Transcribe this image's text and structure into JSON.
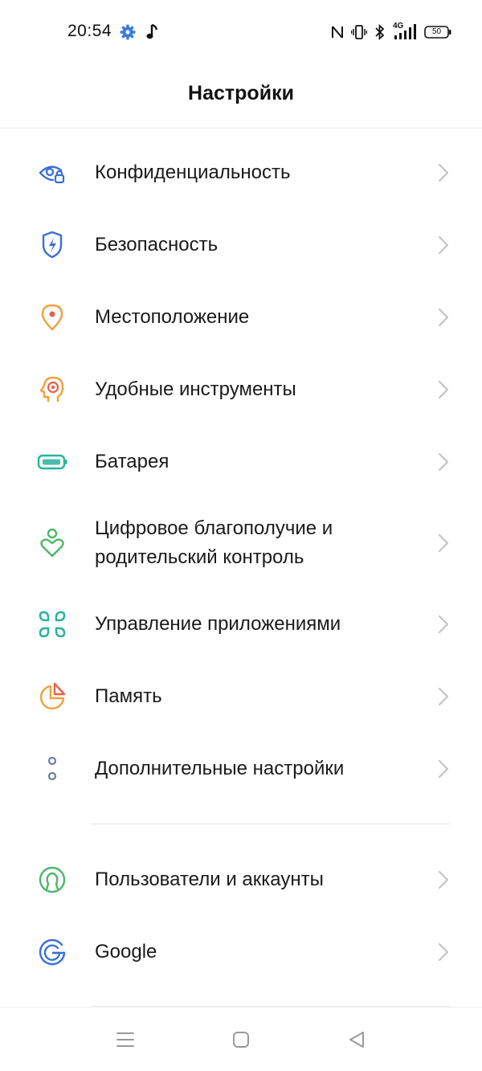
{
  "status_bar": {
    "time": "20:54",
    "icons_left": [
      "gear-icon",
      "music-note-icon"
    ],
    "icons_right": [
      "nfc-icon",
      "vibrate-icon",
      "bluetooth-icon",
      "signal-4g-icon",
      "battery-icon"
    ],
    "network_label": "4G",
    "battery_level": "50"
  },
  "header": {
    "title": "Настройки"
  },
  "settings": {
    "items": [
      {
        "label": "Конфиденциальность",
        "icon": "privacy-eye-icon",
        "color": "#3a6fd8"
      },
      {
        "label": "Безопасность",
        "icon": "shield-bolt-icon",
        "color": "#3a6fd8"
      },
      {
        "label": "Местоположение",
        "icon": "location-pin-icon",
        "color": "#f0a23a"
      },
      {
        "label": "Удобные инструменты",
        "icon": "head-target-icon",
        "color": "#f0a23a"
      },
      {
        "label": "Батарея",
        "icon": "battery-icon",
        "color": "#27b39a"
      },
      {
        "label": "Цифровое благополучие и родительский контроль",
        "icon": "person-heart-icon",
        "color": "#4cb86a"
      },
      {
        "label": "Управление приложениями",
        "icon": "apps-grid-icon",
        "color": "#27b39a"
      },
      {
        "label": "Память",
        "icon": "storage-pie-icon",
        "color": "#f0a23a"
      },
      {
        "label": "Дополнительные настройки",
        "icon": "more-dots-icon",
        "color": "#6d7ea0"
      }
    ],
    "account_items": [
      {
        "label": "Пользователи и аккаунты",
        "icon": "user-circle-icon",
        "color": "#4cb86a"
      },
      {
        "label": "Google",
        "icon": "google-g-icon",
        "color": "#3a6fd8"
      }
    ]
  },
  "nav_bar": {
    "buttons": [
      "menu-icon",
      "home-icon",
      "back-icon"
    ]
  }
}
